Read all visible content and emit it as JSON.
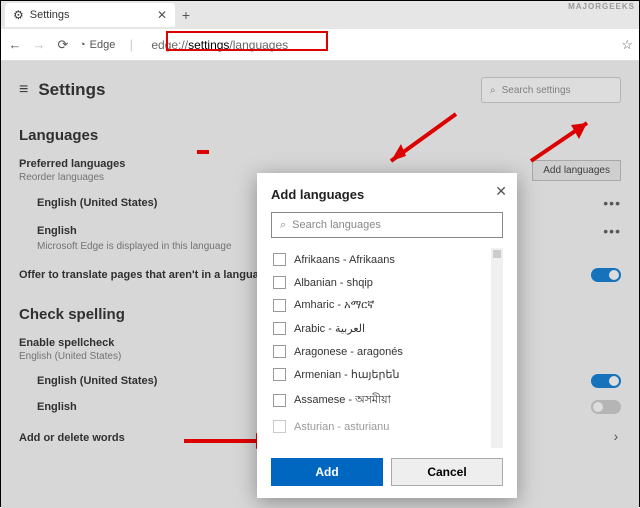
{
  "tab": {
    "title": "Settings"
  },
  "address": {
    "origin": "Edge",
    "url_prefix": "edge://",
    "url_strong": "settings",
    "url_suffix": "/languages"
  },
  "header": {
    "title": "Settings",
    "search_placeholder": "Search settings"
  },
  "languages": {
    "section": "Languages",
    "preferred_label": "Preferred languages",
    "reorder": "Reorder languages",
    "add_button": "Add languages",
    "items": [
      {
        "label": "English (United States)",
        "sub": ""
      },
      {
        "label": "English",
        "sub": "Microsoft Edge is displayed in this language"
      }
    ],
    "translate": "Offer to translate pages that aren't in a language I read"
  },
  "spelling": {
    "section": "Check spelling",
    "enable": "Enable spellcheck",
    "enable_sub": "English (United States)",
    "items": [
      {
        "label": "English (United States)",
        "on": true
      },
      {
        "label": "English",
        "on": false
      }
    ],
    "add_delete": "Add or delete words"
  },
  "dialog": {
    "title": "Add languages",
    "search_placeholder": "Search languages",
    "options": [
      "Afrikaans - Afrikaans",
      "Albanian - shqip",
      "Amharic - አማርኛ",
      "Arabic - العربية",
      "Aragonese - aragonés",
      "Armenian - հայերեն",
      "Assamese - অসমীয়া",
      "Asturian - asturianu"
    ],
    "add": "Add",
    "cancel": "Cancel"
  },
  "watermark": "MAJORGEEKS"
}
